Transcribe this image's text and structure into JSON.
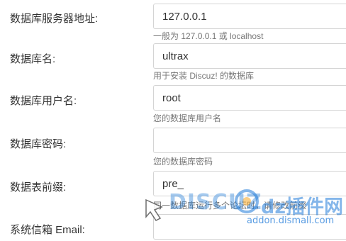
{
  "form": {
    "rows": [
      {
        "label": "数据库服务器地址:",
        "value": "127.0.0.1",
        "hint": "一般为 127.0.0.1 或 localhost"
      },
      {
        "label": "数据库名:",
        "value": "ultrax",
        "hint": "用于安装 Discuz! 的数据库"
      },
      {
        "label": "数据库用户名:",
        "value": "root",
        "hint": "您的数据库用户名"
      },
      {
        "label": "数据库密码:",
        "value": "",
        "hint": "您的数据库密码"
      },
      {
        "label": "数据表前缀:",
        "value": "pre_",
        "hint": "同一数据库运行多个论坛时，请修改前缀"
      },
      {
        "label": "系统信箱 Email:",
        "value": "",
        "hint": ""
      }
    ]
  },
  "watermark": {
    "logo_text": "DISCUZ",
    "site_name": "dz插件网",
    "site_url": "addon.dismall.com",
    "colors": {
      "blue": "#1f7ad8",
      "orange": "#f5a623",
      "red": "#e02020"
    }
  }
}
